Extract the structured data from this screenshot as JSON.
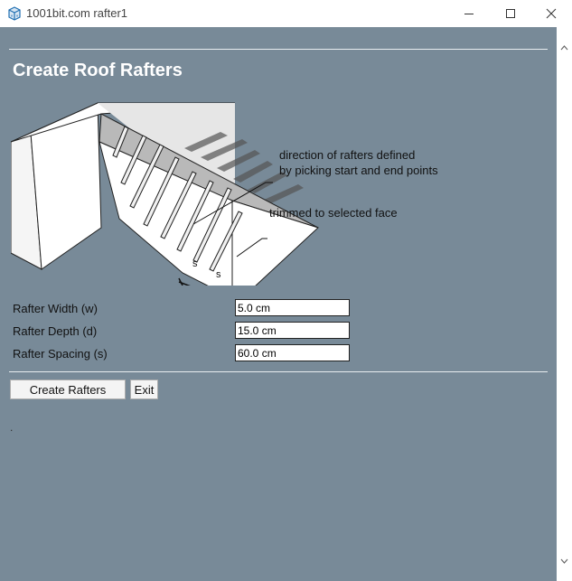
{
  "window": {
    "title": "1001bit.com rafter1",
    "controls": [
      "minimize",
      "maximize",
      "close"
    ]
  },
  "page": {
    "heading": "Create Roof Rafters"
  },
  "illustration": {
    "annotation_direction_line1": "direction of rafters defined",
    "annotation_direction_line2": "by picking start and end points",
    "annotation_trim": "trimmed to selected face",
    "spacing_marker_1": "s",
    "spacing_marker_2": "s"
  },
  "form": {
    "fields": [
      {
        "label": "Rafter Width (w)",
        "value": "5.0 cm"
      },
      {
        "label": "Rafter Depth (d)",
        "value": "15.0 cm"
      },
      {
        "label": "Rafter Spacing (s)",
        "value": "60.0 cm"
      }
    ]
  },
  "buttons": {
    "create_label": "Create Rafters",
    "exit_label": "Exit"
  },
  "status": {
    "text": "."
  },
  "colors": {
    "content_background": "#788a98",
    "heading_text": "#ffffff",
    "divider": "#e8edf0"
  }
}
